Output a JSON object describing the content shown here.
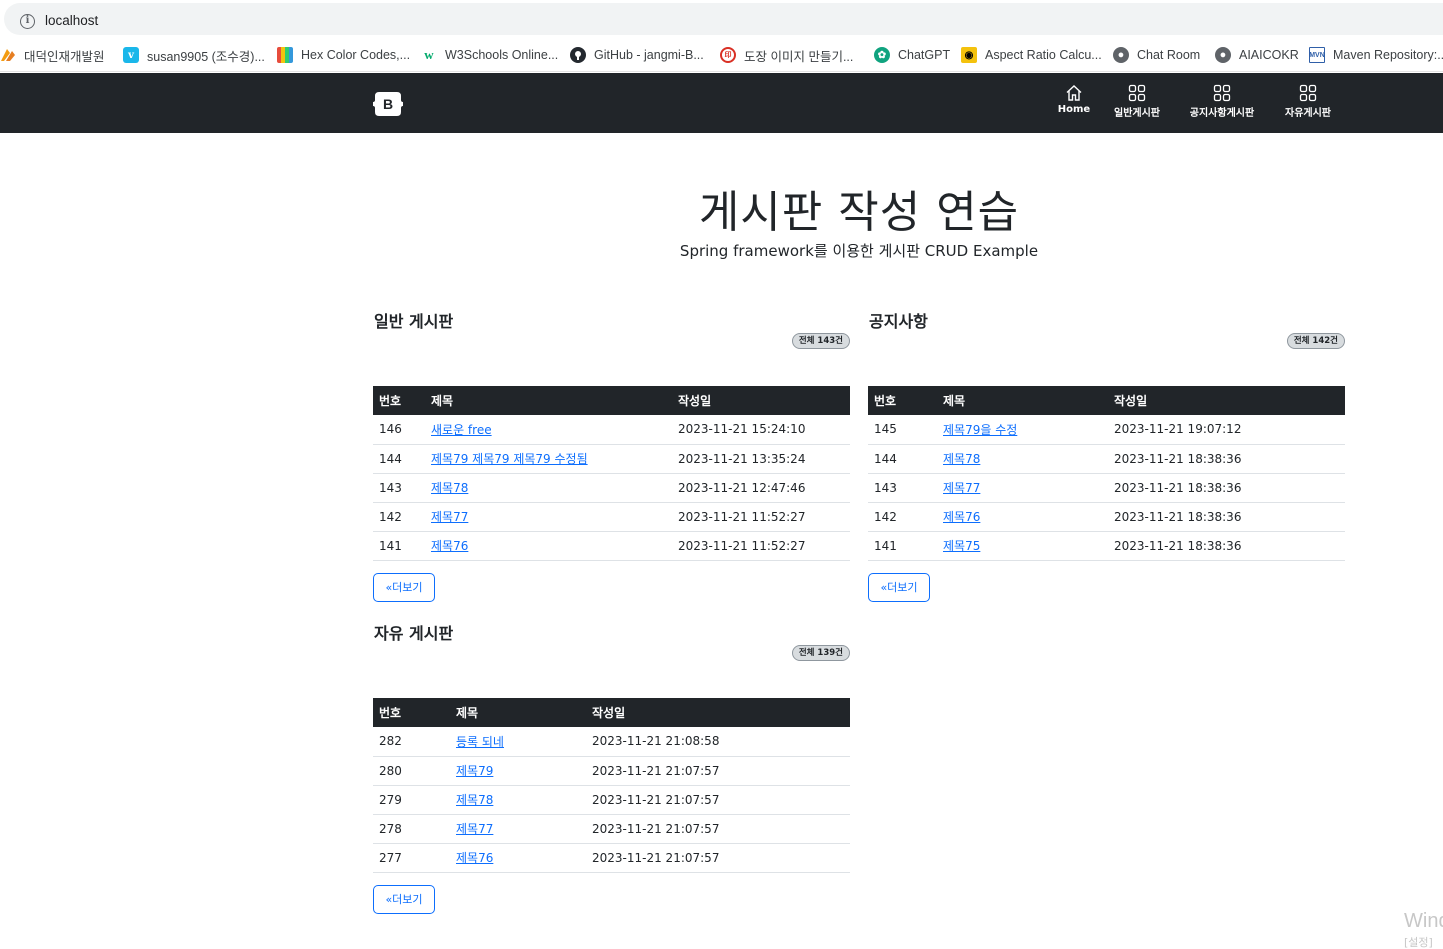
{
  "browser": {
    "address": "localhost",
    "bookmarks": [
      {
        "label": "대덕인재개발원",
        "icon": "ddit-icon",
        "color": "#f39c12"
      },
      {
        "label": "susan9905 (조수경)...",
        "icon": "vimeo-icon",
        "color": "#1ab7ea"
      },
      {
        "label": "Hex Color Codes,...",
        "icon": "colors-icon",
        "color": "#8e44ad"
      },
      {
        "label": "W3Schools Online...",
        "icon": "w3schools-icon",
        "color": "#04aa6d"
      },
      {
        "label": "GitHub - jangmi-B...",
        "icon": "github-icon",
        "color": "#24292f"
      },
      {
        "label": "도장 이미지 만들기...",
        "icon": "stamp-icon",
        "color": "#d93025"
      },
      {
        "label": "ChatGPT",
        "icon": "chatgpt-icon",
        "color": "#10a37f"
      },
      {
        "label": "Aspect Ratio Calcu...",
        "icon": "aspect-ratio-icon",
        "color": "#f4c20d"
      },
      {
        "label": "Chat Room",
        "icon": "globe-icon",
        "color": "#5f6368"
      },
      {
        "label": "AIAICOKR",
        "icon": "globe-icon",
        "color": "#5f6368"
      },
      {
        "label": "Maven Repository:...",
        "icon": "maven-icon",
        "color": "#2f5fa8"
      }
    ]
  },
  "navbar": {
    "brand": "B",
    "items": [
      {
        "label": "Home",
        "icon": "house-icon"
      },
      {
        "label": "일반게시판",
        "icon": "grid-icon"
      },
      {
        "label": "공지사항게시판",
        "icon": "grid-icon"
      },
      {
        "label": "자유게시판",
        "icon": "grid-icon"
      }
    ]
  },
  "hero": {
    "title": "게시판 작성 연습",
    "subtitle": "Spring framework를 이용한 게시판 CRUD Example"
  },
  "boards": {
    "general": {
      "title": "일반 게시판",
      "badge": "전체 143건",
      "headers": [
        "번호",
        "제목",
        "작성일"
      ],
      "rows": [
        {
          "no": "146",
          "title": "새로운 free",
          "date": "2023-11-21 15:24:10"
        },
        {
          "no": "144",
          "title": "제목79 제목79 제목79 수정됨",
          "date": "2023-11-21 13:35:24"
        },
        {
          "no": "143",
          "title": "제목78",
          "date": "2023-11-21 12:47:46"
        },
        {
          "no": "142",
          "title": "제목77",
          "date": "2023-11-21 11:52:27"
        },
        {
          "no": "141",
          "title": "제목76",
          "date": "2023-11-21 11:52:27"
        }
      ],
      "more": "«더보기"
    },
    "notice": {
      "title": "공지사항",
      "badge": "전체 142건",
      "headers": [
        "번호",
        "제목",
        "작성일"
      ],
      "rows": [
        {
          "no": "145",
          "title": "제목79을 수정",
          "date": "2023-11-21 19:07:12"
        },
        {
          "no": "144",
          "title": "제목78",
          "date": "2023-11-21 18:38:36"
        },
        {
          "no": "143",
          "title": "제목77",
          "date": "2023-11-21 18:38:36"
        },
        {
          "no": "142",
          "title": "제목76",
          "date": "2023-11-21 18:38:36"
        },
        {
          "no": "141",
          "title": "제목75",
          "date": "2023-11-21 18:38:36"
        }
      ],
      "more": "«더보기"
    },
    "free": {
      "title": "자유 게시판",
      "badge": "전체 139건",
      "headers": [
        "번호",
        "제목",
        "작성일"
      ],
      "rows": [
        {
          "no": "282",
          "title": "등록 되네",
          "date": "2023-11-21 21:08:58"
        },
        {
          "no": "280",
          "title": "제목79",
          "date": "2023-11-21 21:07:57"
        },
        {
          "no": "279",
          "title": "제목78",
          "date": "2023-11-21 21:07:57"
        },
        {
          "no": "278",
          "title": "제목77",
          "date": "2023-11-21 21:07:57"
        },
        {
          "no": "277",
          "title": "제목76",
          "date": "2023-11-21 21:07:57"
        }
      ],
      "more": "«더보기"
    }
  },
  "watermark": {
    "line1": "Wind",
    "line2": "[설정]"
  }
}
